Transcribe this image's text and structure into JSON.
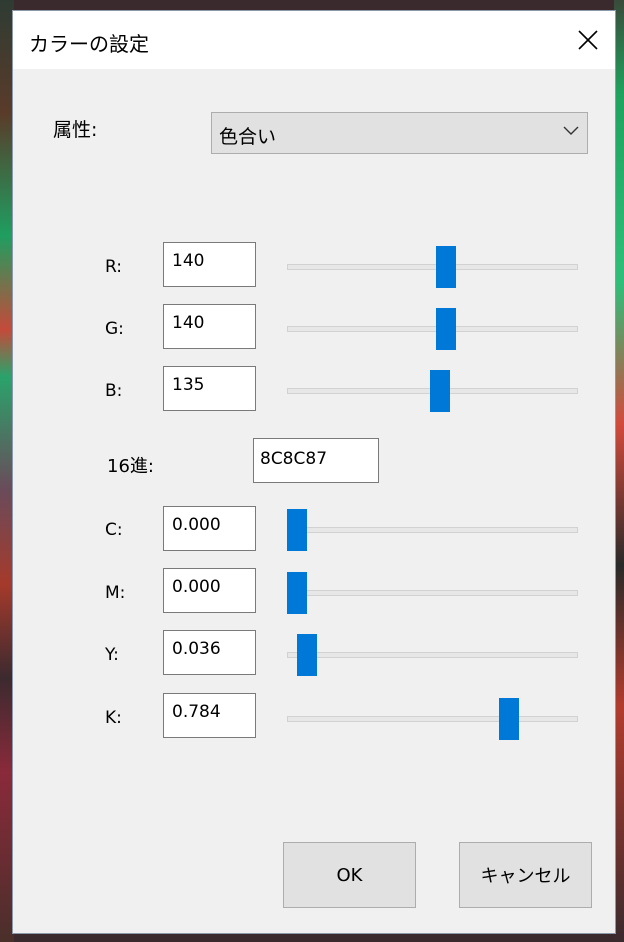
{
  "window": {
    "title": "カラーの設定"
  },
  "attribute": {
    "label": "属性:",
    "selected": "色合い"
  },
  "rgb": [
    {
      "label": "R:",
      "value": "140",
      "level": 140,
      "max": 255
    },
    {
      "label": "G:",
      "value": "140",
      "level": 140,
      "max": 255
    },
    {
      "label": "B:",
      "value": "135",
      "level": 135,
      "max": 255
    }
  ],
  "hex": {
    "label": "16進:",
    "value": "8C8C87"
  },
  "cmyk": [
    {
      "label": "C:",
      "value": "0.000",
      "level": 0.0
    },
    {
      "label": "M:",
      "value": "0.000",
      "level": 0.0
    },
    {
      "label": "Y:",
      "value": "0.036",
      "level": 0.036
    },
    {
      "label": "K:",
      "value": "0.784",
      "level": 0.784
    }
  ],
  "buttons": {
    "ok": "OK",
    "cancel": "キャンセル"
  },
  "colors": {
    "slider_thumb": "#0078d7",
    "window_bg": "#f0f0f0",
    "titlebar_bg": "#ffffff"
  }
}
